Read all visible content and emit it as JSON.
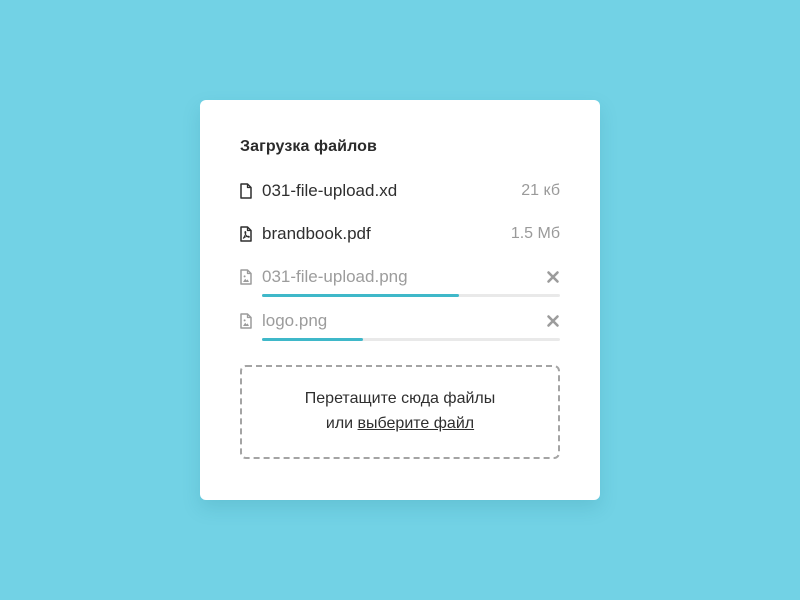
{
  "colors": {
    "background": "#72d2e5",
    "card": "#ffffff",
    "progress": "#3fb8c9",
    "text_primary": "#2f2f2f",
    "text_muted": "#9a9a9a"
  },
  "upload": {
    "title": "Загрузка файлов",
    "files": [
      {
        "name": "031-file-upload.xd",
        "size": "21  кб",
        "icon": "file-icon",
        "state": "uploaded"
      },
      {
        "name": "brandbook.pdf",
        "size": "1.5 Мб",
        "icon": "pdf-file-icon",
        "state": "uploaded"
      },
      {
        "name": "031-file-upload.png",
        "icon": "image-file-icon",
        "state": "uploading",
        "progress_percent": 66,
        "remove_icon": "close-icon"
      },
      {
        "name": "logo.png",
        "icon": "image-file-icon",
        "state": "uploading",
        "progress_percent": 34,
        "remove_icon": "close-icon"
      }
    ],
    "dropzone": {
      "line1": "Перетащите сюда файлы",
      "line2_prefix": "или ",
      "link_text": "выберите файл"
    }
  }
}
